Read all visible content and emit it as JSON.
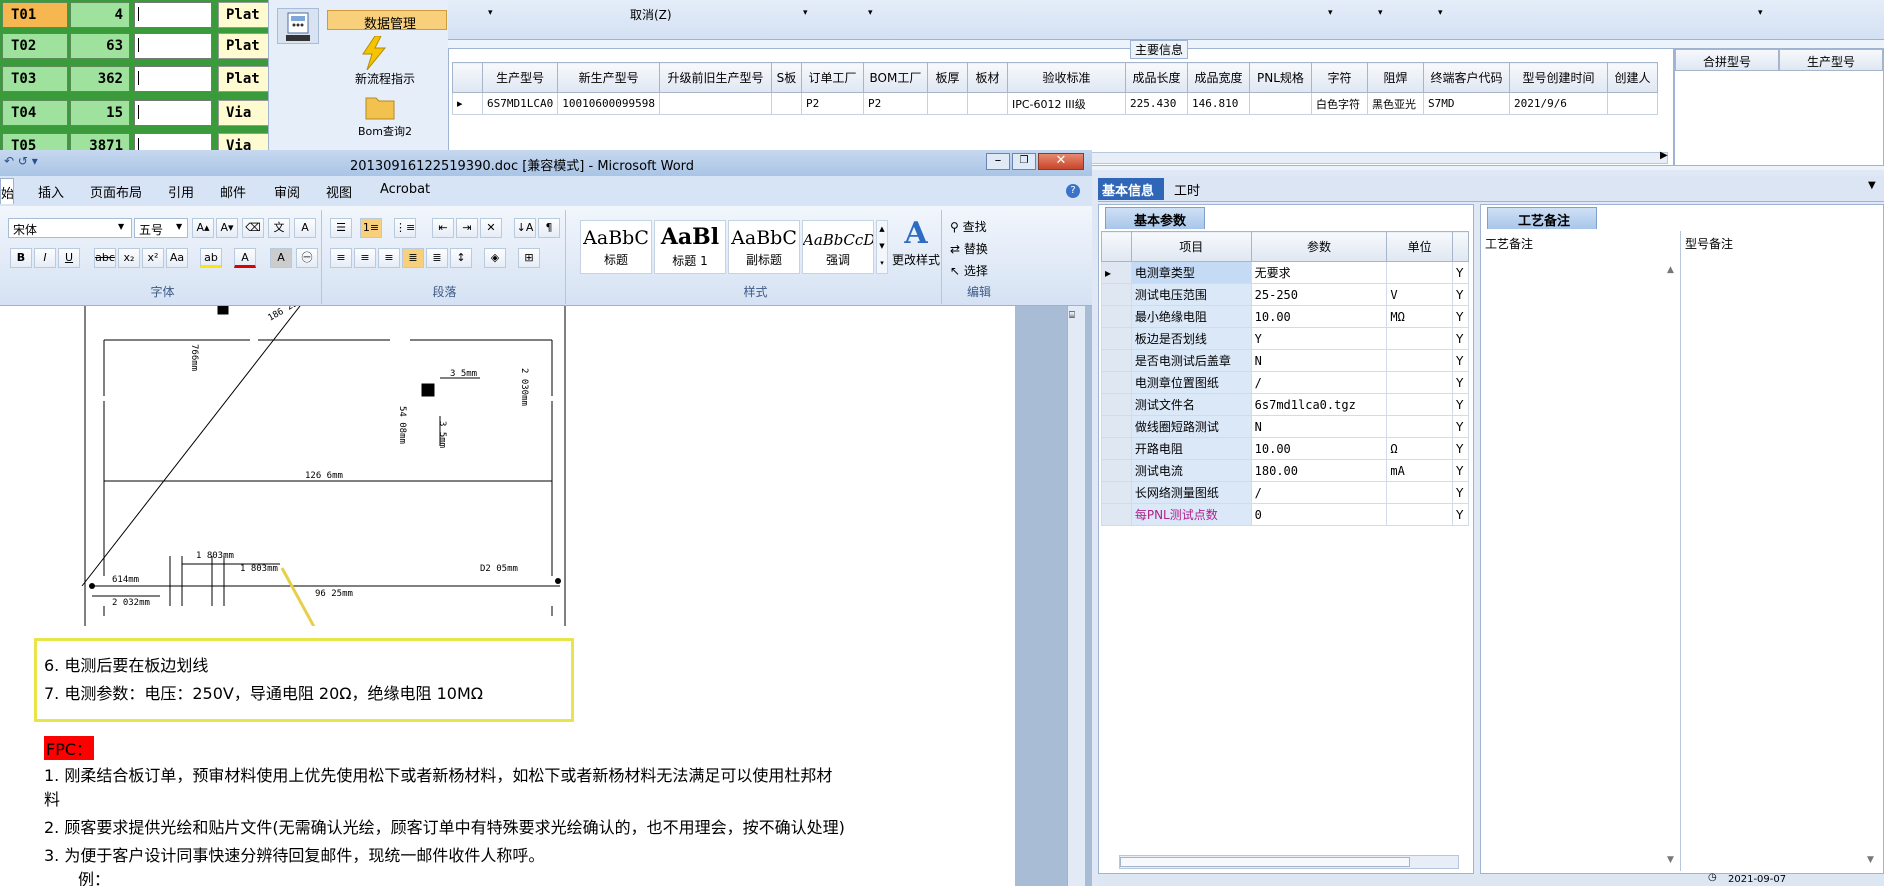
{
  "left_grid": {
    "rows": [
      {
        "code": "T01",
        "count": "4",
        "type": "Plat",
        "selected": true
      },
      {
        "code": "T02",
        "count": "63",
        "type": "Plat",
        "selected": false
      },
      {
        "code": "T03",
        "count": "362",
        "type": "Plat",
        "selected": false
      },
      {
        "code": "T04",
        "count": "15",
        "type": "Via",
        "selected": false
      },
      {
        "code": "T05",
        "count": "3871",
        "type": "Via",
        "selected": false
      }
    ]
  },
  "side_menu": {
    "items": [
      {
        "label": "数据管理",
        "selected": true
      },
      {
        "label": "新流程指示",
        "selected": false
      },
      {
        "label": "Bom查询2",
        "selected": false
      }
    ]
  },
  "top_bar": {
    "cancel_label": "取消(Z)"
  },
  "main_info": {
    "title": "主要信息",
    "columns": [
      "生产型号",
      "新生产型号",
      "升级前旧生产型号",
      "S板",
      "订单工厂",
      "BOM工厂",
      "板厚",
      "板材",
      "验收标准",
      "成品长度",
      "成品宽度",
      "PNL规格",
      "字符",
      "阻焊",
      "终端客户代码",
      "型号创建时间",
      "创建人"
    ],
    "row": [
      "6S7MD1LCA0",
      "10010600099598",
      "",
      "",
      "P2",
      "P2",
      "",
      "",
      "IPC-6012 III级",
      "225.430",
      "146.810",
      "",
      "白色字符",
      "黑色亚光",
      "S7MD",
      "2021/9/6",
      ""
    ],
    "side_columns": [
      "合拼型号",
      "生产型号"
    ]
  },
  "word": {
    "title": "20130916122519390.doc [兼容模式] - Microsoft Word",
    "tabs": [
      "始",
      "插入",
      "页面布局",
      "引用",
      "邮件",
      "审阅",
      "视图",
      "Acrobat"
    ],
    "font_name": "宋体",
    "font_size": "五号",
    "groups": {
      "font": "字体",
      "paragraph": "段落",
      "styles": "样式",
      "edit": "编辑"
    },
    "styles": [
      {
        "sample": "AaBbC",
        "label": "标题"
      },
      {
        "sample": "AaBl",
        "label": "标题 1"
      },
      {
        "sample": "AaBbC",
        "label": "副标题"
      },
      {
        "sample": "AaBbCcD",
        "label": "强调"
      }
    ],
    "change_styles": "更改样式",
    "edit": {
      "find": "查找",
      "replace": "替换",
      "select": "选择"
    },
    "drawing": {
      "d1": "186 25mm",
      "d2": "766mm",
      "d3": "3 5mm",
      "d4": "2 030mm",
      "d5": "54 08mm",
      "d6": "3 5mm",
      "d7": "126 6mm",
      "d8": "1 803mm",
      "d9": "1 803mm",
      "d10": "614mm",
      "d11": "96 25mm",
      "d12": "D2 05mm",
      "d13": "2 032mm"
    },
    "note_lines": [
      "6.   电测后要在板边划线",
      "7.   电测参数：电压：250V，导通电阻 20Ω，绝缘电阻 10MΩ"
    ],
    "fpc_label": "FPC：",
    "body_lines": [
      "1.  刚柔结合板订单，预审材料使用上优先使用松下或者新杨材料，如松下或者新杨材料无法满足可以使用杜邦材",
      "料",
      "2.  顾客要求提供光绘和贴片文件(无需确认光绘，顾客订单中有特殊要求光绘确认的，也不用理会，按不确认处理)",
      "3. 为便于客户设计同事快速分辨待回复邮件，现统一邮件收件人称呼。",
      "例："
    ]
  },
  "right_tabs": {
    "basic": "基本信息",
    "hours": "工时",
    "params_tab": "基本参数",
    "notes_tab": "工艺备注"
  },
  "params": {
    "columns": [
      "项目",
      "参数",
      "单位"
    ],
    "rows": [
      {
        "item": "电测章类型",
        "value": "无要求",
        "unit": "",
        "flag": "Y"
      },
      {
        "item": "测试电压范围",
        "value": "25-250",
        "unit": "V",
        "flag": "Y"
      },
      {
        "item": "最小绝缘电阻",
        "value": "10.00",
        "unit": "MΩ",
        "flag": "Y"
      },
      {
        "item": "板边是否划线",
        "value": "Y",
        "unit": "",
        "flag": "Y"
      },
      {
        "item": "是否电测试后盖章",
        "value": "N",
        "unit": "",
        "flag": "Y"
      },
      {
        "item": "电测章位置图纸",
        "value": "/",
        "unit": "",
        "flag": "Y"
      },
      {
        "item": "测试文件名",
        "value": "6s7md1lca0.tgz",
        "unit": "",
        "flag": "Y"
      },
      {
        "item": "做线圈短路测试",
        "value": "N",
        "unit": "",
        "flag": "Y"
      },
      {
        "item": "开路电阻",
        "value": "10.00",
        "unit": "Ω",
        "flag": "Y"
      },
      {
        "item": "测试电流",
        "value": "180.00",
        "unit": "mA",
        "flag": "Y"
      },
      {
        "item": "长网络测量图纸",
        "value": "/",
        "unit": "",
        "flag": "Y"
      },
      {
        "item": "每PNL测试点数",
        "value": "0",
        "unit": "",
        "flag": "Y"
      }
    ]
  },
  "notes": {
    "col1": "工艺备注",
    "col2": "型号备注"
  },
  "status": {
    "date": "2021-09-07"
  }
}
